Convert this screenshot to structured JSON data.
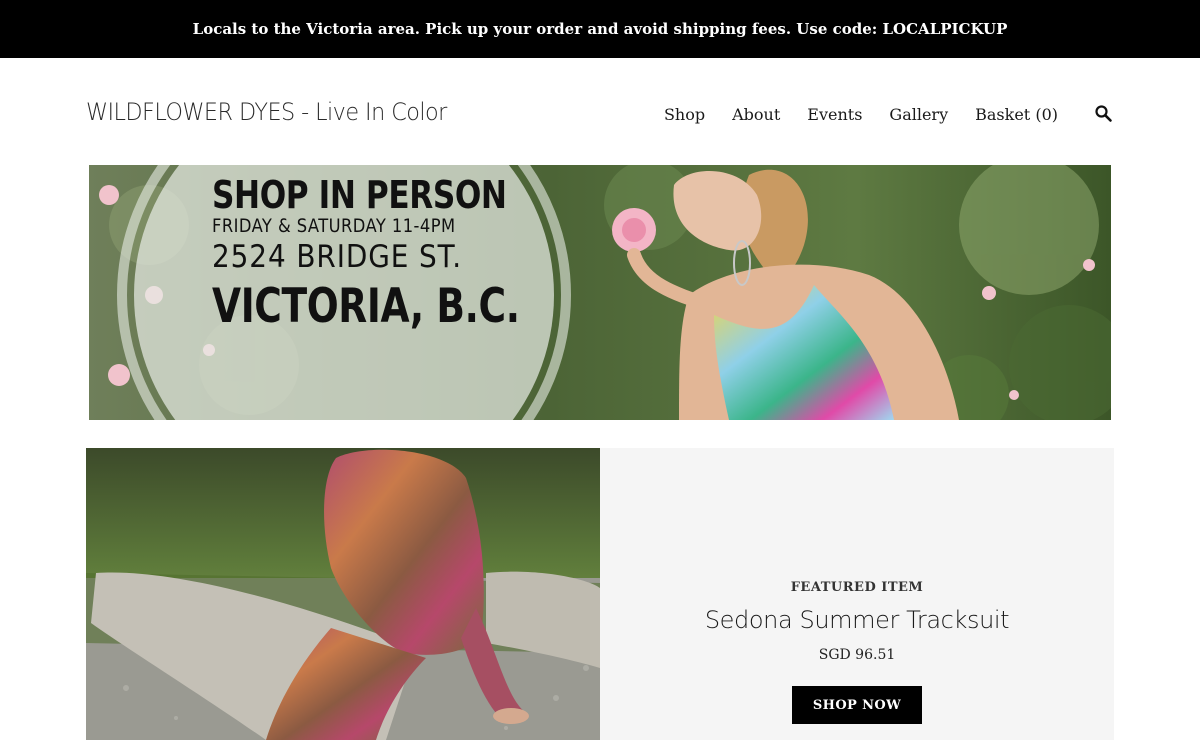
{
  "announcement": {
    "text": "Locals to the Victoria area. Pick up your order and avoid shipping fees. Use code: LOCALPICKUP"
  },
  "header": {
    "site_title": "WILDFLOWER DYES - Live In Color",
    "nav": {
      "shop": "Shop",
      "about": "About",
      "events": "Events",
      "gallery": "Gallery",
      "basket": "Basket",
      "basket_count": "(0)"
    },
    "search_icon": "search-icon"
  },
  "hero": {
    "line1": "SHOP IN PERSON",
    "line2": "FRIDAY & SATURDAY 11-4PM",
    "line3": "2524 BRIDGE ST.",
    "line4": "VICTORIA, B.C."
  },
  "featured": {
    "label": "FEATURED ITEM",
    "name": "Sedona Summer Tracksuit",
    "price": "SGD 96.51",
    "button": "SHOP NOW"
  },
  "colors": {
    "announcement_bg": "#000000",
    "featured_bg": "#f5f5f5",
    "button_bg": "#000000"
  }
}
